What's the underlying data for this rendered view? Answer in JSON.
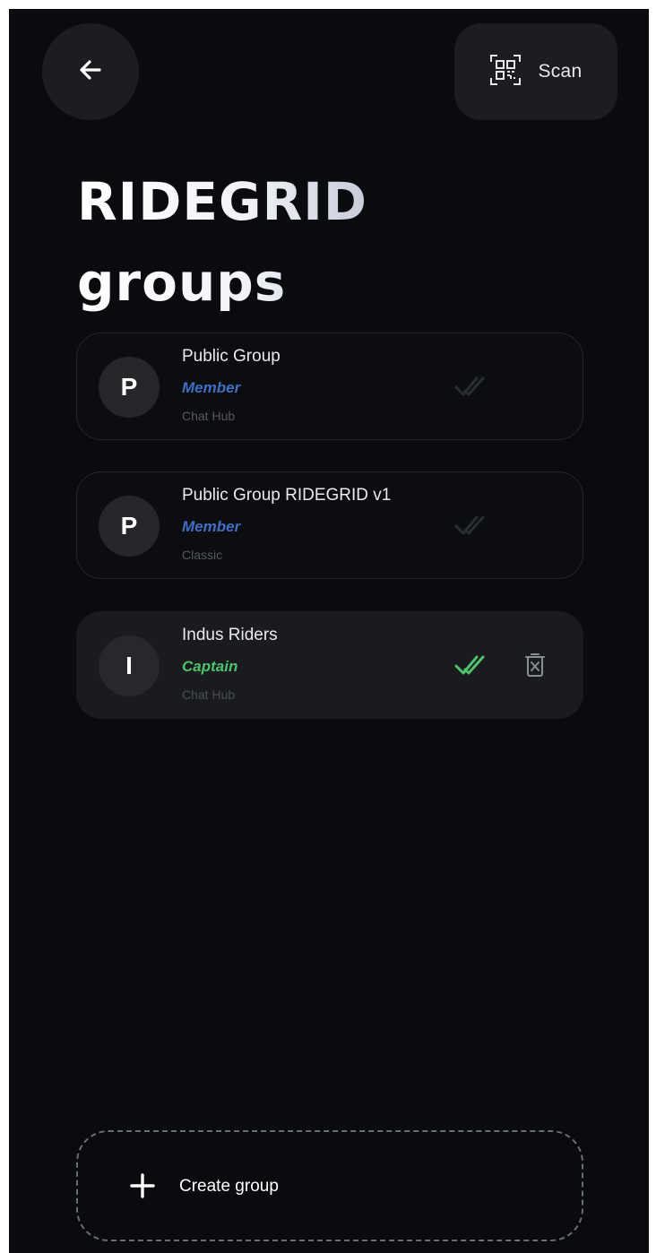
{
  "header": {
    "back_icon": "arrow-left-icon",
    "scan_icon": "qr-scan-icon",
    "scan_label": "Scan"
  },
  "title": {
    "line1": "RIDEGRID",
    "line2": "groups"
  },
  "groups": [
    {
      "initial": "P",
      "name": "Public Group",
      "role": "Member",
      "type": "Chat Hub",
      "active": false,
      "check_icon": "double-check-icon"
    },
    {
      "initial": "P",
      "name": "Public Group RIDEGRID v1",
      "role": "Member",
      "type": "Classic",
      "active": false,
      "check_icon": "double-check-icon"
    },
    {
      "initial": "I",
      "name": "Indus Riders",
      "role": "Captain",
      "type": "Chat Hub",
      "active": true,
      "check_icon": "double-check-icon",
      "delete_icon": "trash-icon"
    }
  ],
  "create": {
    "icon": "plus-icon",
    "label": "Create group"
  },
  "colors": {
    "background": "#0a0b0e",
    "member": "#3f6ec2",
    "captain": "#4fc16d",
    "check_active": "#4fc16d",
    "check_inactive": "#2a2d33"
  }
}
